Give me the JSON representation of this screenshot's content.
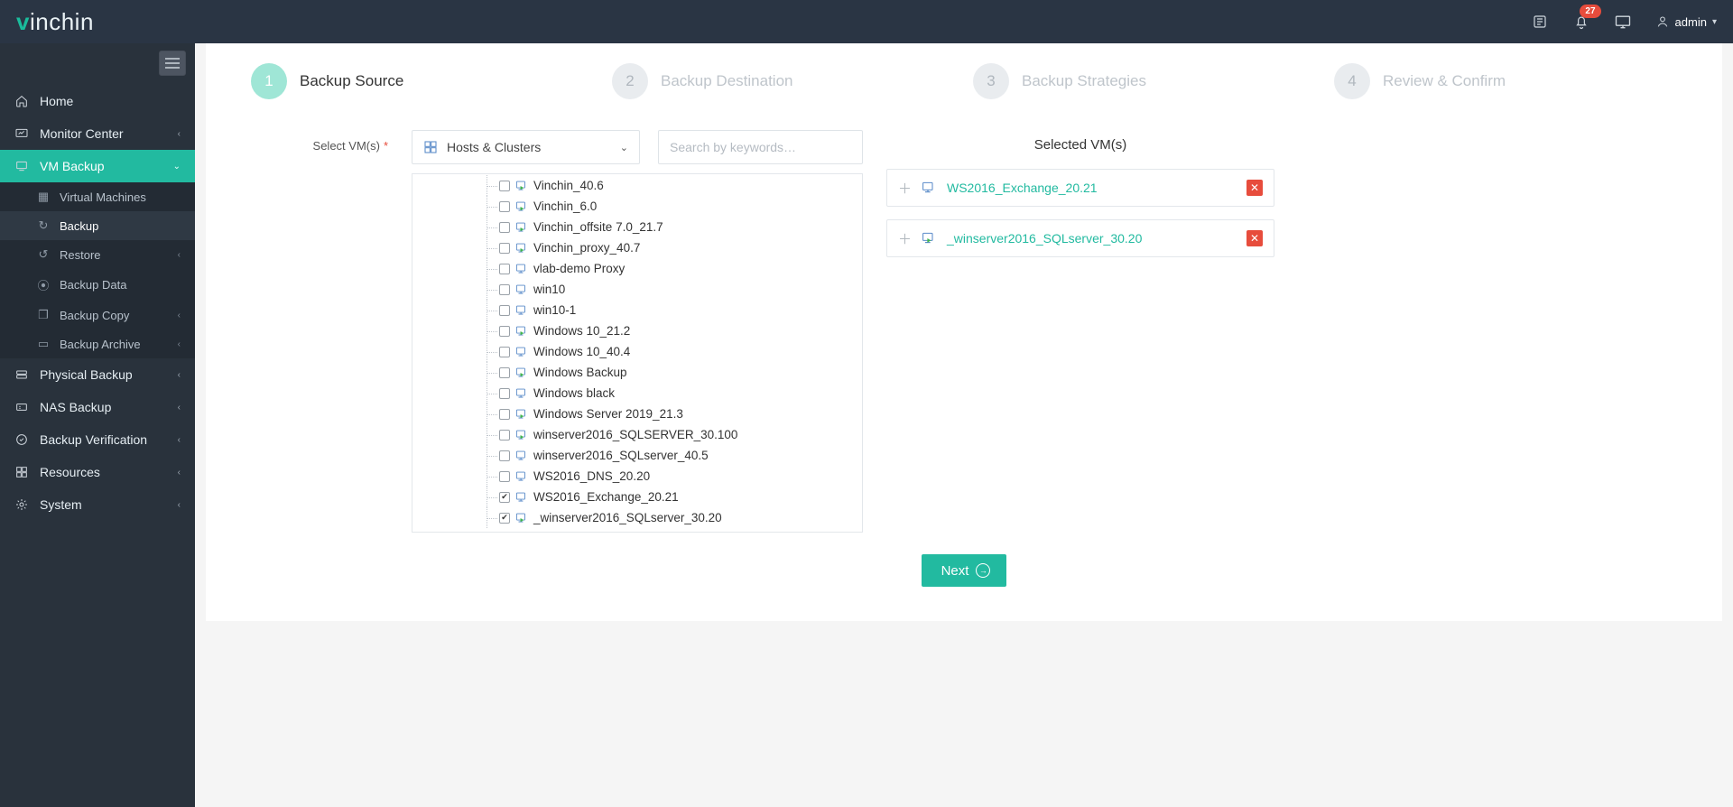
{
  "header": {
    "notifications": "27",
    "user": "admin"
  },
  "sidebar": {
    "items": [
      {
        "label": "Home"
      },
      {
        "label": "Monitor Center",
        "expandable": true
      },
      {
        "label": "VM Backup",
        "expandable": true,
        "active": true
      },
      {
        "label": "Physical Backup",
        "expandable": true
      },
      {
        "label": "NAS Backup",
        "expandable": true
      },
      {
        "label": "Backup Verification",
        "expandable": true
      },
      {
        "label": "Resources",
        "expandable": true
      },
      {
        "label": "System",
        "expandable": true
      }
    ],
    "vm_backup_sub": [
      {
        "label": "Virtual Machines"
      },
      {
        "label": "Backup",
        "selected": true
      },
      {
        "label": "Restore",
        "expandable": true
      },
      {
        "label": "Backup Data"
      },
      {
        "label": "Backup Copy",
        "expandable": true
      },
      {
        "label": "Backup Archive",
        "expandable": true
      }
    ]
  },
  "wizard": {
    "steps": [
      {
        "num": "1",
        "title": "Backup Source",
        "active": true
      },
      {
        "num": "2",
        "title": "Backup Destination"
      },
      {
        "num": "3",
        "title": "Backup Strategies"
      },
      {
        "num": "4",
        "title": "Review & Confirm"
      }
    ]
  },
  "form": {
    "select_label": "Select VM(s)",
    "dropdown": "Hosts & Clusters",
    "search_placeholder": "Search by keywords…"
  },
  "tree": [
    {
      "name": "Vinchin_40.6",
      "on": true
    },
    {
      "name": "Vinchin_6.0",
      "on": true
    },
    {
      "name": "Vinchin_offsite 7.0_21.7",
      "on": true
    },
    {
      "name": "Vinchin_proxy_40.7",
      "on": true
    },
    {
      "name": "vlab-demo Proxy",
      "on": false
    },
    {
      "name": "win10",
      "on": false
    },
    {
      "name": "win10-1",
      "on": false
    },
    {
      "name": "Windows 10_21.2",
      "on": true
    },
    {
      "name": "Windows 10_40.4",
      "on": false
    },
    {
      "name": "Windows Backup",
      "on": true
    },
    {
      "name": "Windows black",
      "on": false
    },
    {
      "name": "Windows Server 2019_21.3",
      "on": true
    },
    {
      "name": "winserver2016_SQLSERVER_30.100",
      "on": true
    },
    {
      "name": "winserver2016_SQLserver_40.5",
      "on": false
    },
    {
      "name": "WS2016_DNS_20.20",
      "on": false
    },
    {
      "name": "WS2016_Exchange_20.21",
      "on": false,
      "checked": true
    },
    {
      "name": "_winserver2016_SQLserver_30.20",
      "on": true,
      "checked": true
    }
  ],
  "selected": {
    "header": "Selected VM(s)",
    "items": [
      {
        "name": "WS2016_Exchange_20.21",
        "on": false
      },
      {
        "name": "_winserver2016_SQLserver_30.20",
        "on": true
      }
    ]
  },
  "buttons": {
    "next": "Next"
  }
}
